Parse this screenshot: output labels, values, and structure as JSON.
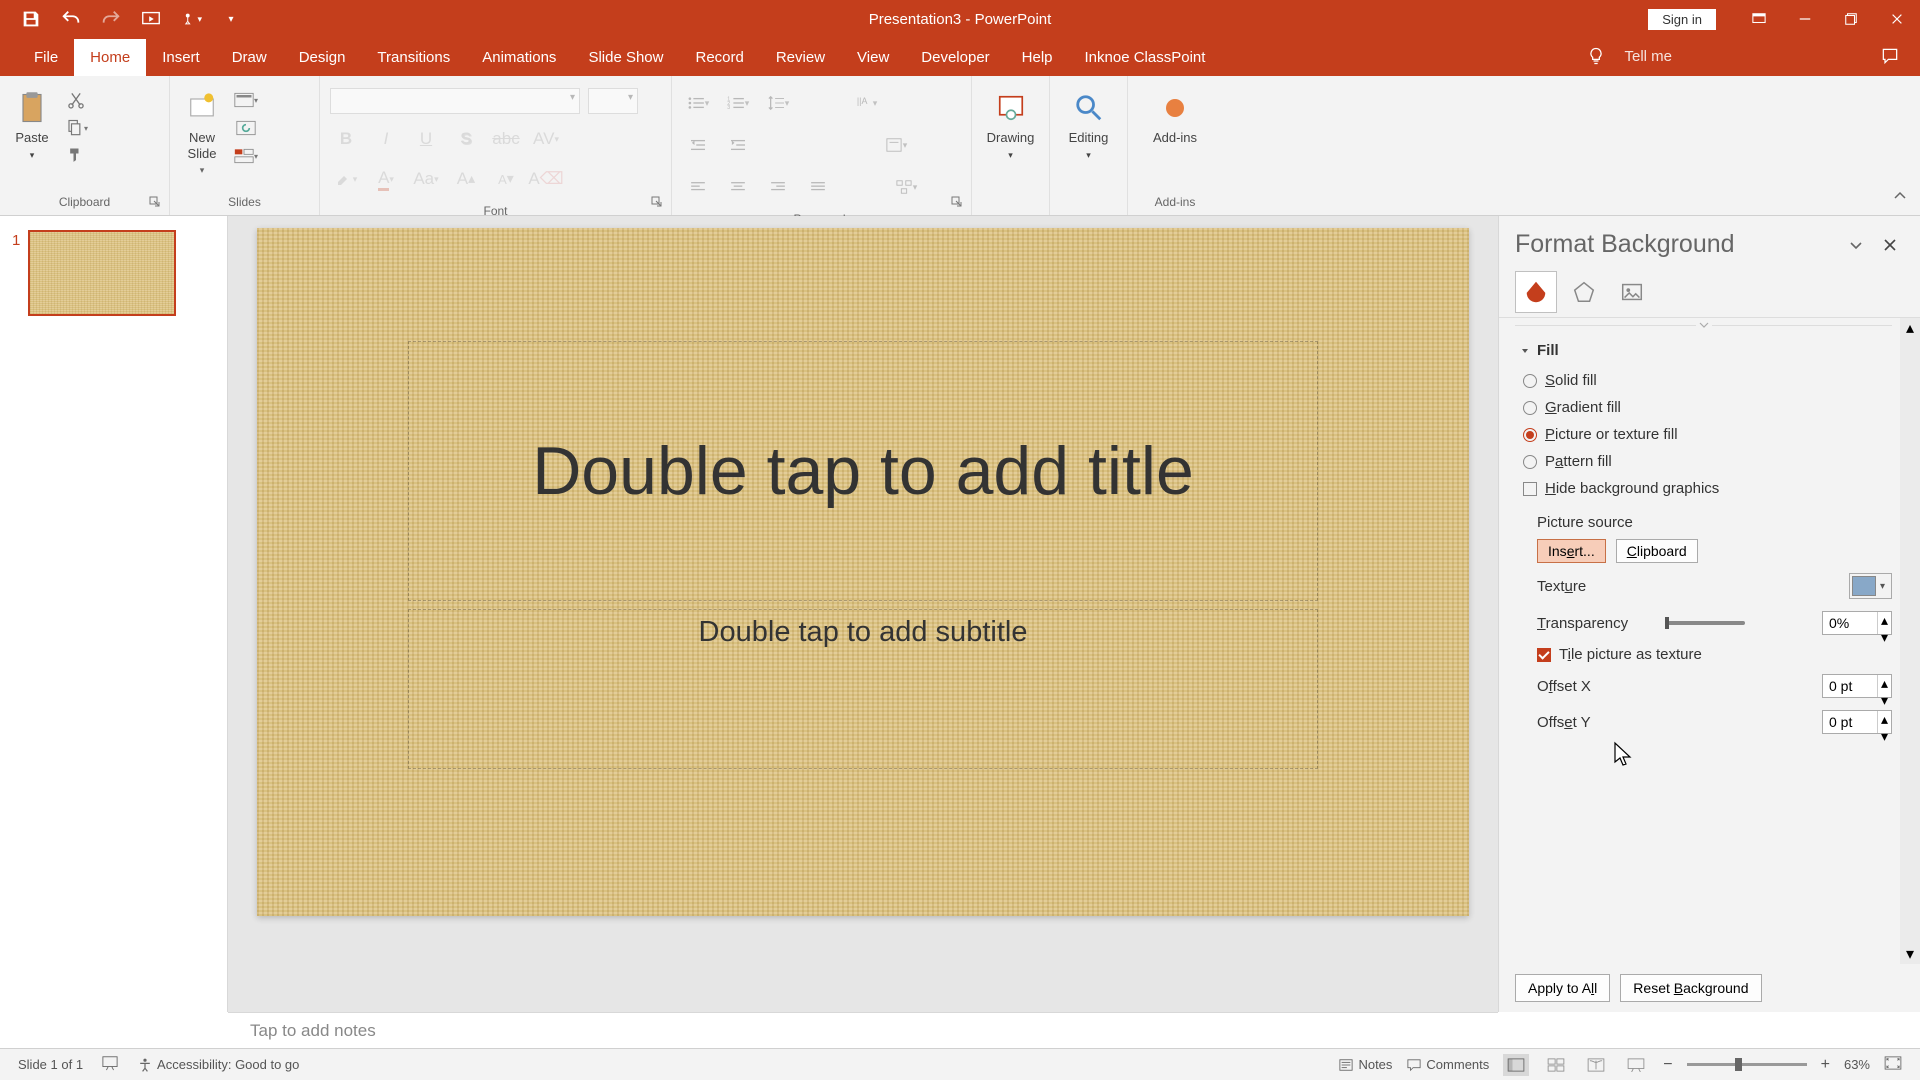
{
  "title": "Presentation3  -  PowerPoint",
  "signin": "Sign in",
  "tabs": {
    "file": "File",
    "home": "Home",
    "insert": "Insert",
    "draw": "Draw",
    "design": "Design",
    "transitions": "Transitions",
    "animations": "Animations",
    "slideshow": "Slide Show",
    "record": "Record",
    "review": "Review",
    "view": "View",
    "developer": "Developer",
    "help": "Help",
    "classpoint": "Inknoe ClassPoint"
  },
  "tellme": "Tell me",
  "ribbon": {
    "clipboard": "Clipboard",
    "paste": "Paste",
    "slides": "Slides",
    "newSlide": "New\nSlide",
    "font": "Font",
    "paragraph": "Paragraph",
    "drawing": "Drawing",
    "editing": "Editing",
    "addins": "Add-ins"
  },
  "fontFamily": "",
  "fontSize": "",
  "thumbnail": {
    "number": "1"
  },
  "slide": {
    "titlePlaceholder": "Double tap to add title",
    "subtitlePlaceholder": "Double tap to add subtitle"
  },
  "formatPane": {
    "title": "Format Background",
    "fillSection": "Fill",
    "options": {
      "solid": "Solid fill",
      "gradient": "Gradient fill",
      "pictureTexture": "Picture or texture fill",
      "pattern": "Pattern fill",
      "hideBg": "Hide background graphics"
    },
    "pictureSource": "Picture source",
    "insertBtn": "Insert...",
    "clipboardBtn": "Clipboard",
    "texture": "Texture",
    "transparency": "Transparency",
    "transparencyVal": "0%",
    "tileCheck": "Tile picture as texture",
    "offsetX": "Offset X",
    "offsetXVal": "0 pt",
    "offsetY": "Offset Y",
    "offsetYVal": "0 pt",
    "applyAll": "Apply to All",
    "reset": "Reset Background"
  },
  "notes": "Tap to add notes",
  "status": {
    "slideCount": "Slide 1 of 1",
    "accessibility": "Accessibility: Good to go",
    "notesBtn": "Notes",
    "commentsBtn": "Comments",
    "zoom": "63%"
  }
}
